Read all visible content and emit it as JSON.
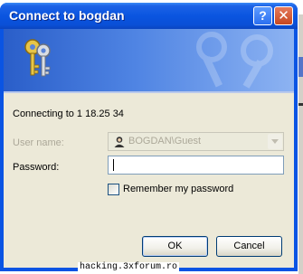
{
  "window": {
    "title": "Connect to bogdan"
  },
  "titlebar": {
    "help_glyph": "?",
    "close_glyph": "✕"
  },
  "banner": {
    "icon": "keys-icon"
  },
  "dialog": {
    "connecting_text": "Connecting to 1    18.25   34",
    "username_label": "User name:",
    "username_value": "BOGDAN\\Guest",
    "password_label": "Password:",
    "password_value": "",
    "remember_label": "Remember my password",
    "remember_checked": false,
    "ok_label": "OK",
    "cancel_label": "Cancel"
  },
  "watermark": {
    "text": "hacking.3xforum.ro"
  },
  "colors": {
    "titlebar": "#0a55e0",
    "client": "#ece9d8",
    "banner": "#4f84e3"
  }
}
